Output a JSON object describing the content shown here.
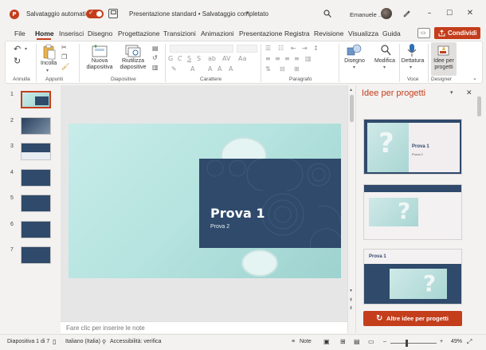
{
  "titlebar": {
    "app_letter": "P",
    "autosave_label": "Salvataggio automatico",
    "autosave_state": "on",
    "doc_title": "Presentazione standard • Salvataggio completato",
    "user_name": "Emanuele ...",
    "accent_color": "#c43e1c"
  },
  "tabs": [
    "File",
    "Home",
    "Inserisci",
    "Disegno",
    "Progettazione",
    "Transizioni",
    "Animazioni",
    "Presentazione",
    "Registra",
    "Revisione",
    "Visualizza",
    "Guida"
  ],
  "active_tab": "Home",
  "share_label": "Condividi",
  "ribbon": {
    "groups": {
      "annulla": "Annulla",
      "appunti": "Appunti",
      "diapositive": "Diapositive",
      "carattere": "Carattere",
      "paragrafo": "Paragrafo",
      "voce": "Voce",
      "designer": "Designer"
    },
    "buttons": {
      "incolla": "Incolla",
      "nuova_diapositiva": [
        "Nuova",
        "diapositiva"
      ],
      "riutilizza": [
        "Riutilizza",
        "diapositive"
      ],
      "disegno": "Disegno",
      "modifica": "Modifica",
      "dettatura": "Dettatura",
      "idee": [
        "Idee per",
        "progetti"
      ]
    }
  },
  "thumbnails": [
    {
      "num": "1",
      "selected": true
    },
    {
      "num": "2",
      "selected": false
    },
    {
      "num": "3",
      "selected": false
    },
    {
      "num": "4",
      "selected": false
    },
    {
      "num": "5",
      "selected": false
    },
    {
      "num": "6",
      "selected": false
    },
    {
      "num": "7",
      "selected": false
    }
  ],
  "slide": {
    "title": "Prova 1",
    "subtitle": "Prova 2"
  },
  "notes_placeholder": "Fare clic per inserire le note",
  "designer": {
    "title": "Idee per progetti",
    "card1_title": "Prova 1",
    "card1_sub": "Prova 2",
    "card3_title": "Prova 1",
    "more_label": "Altre idee per progetti"
  },
  "status": {
    "slide_info": "Diapositiva 1 di 7",
    "language": "Italiano (Italia)",
    "accessibility": "Accessibilità: verifica",
    "notes": "Note",
    "zoom": "49%"
  }
}
